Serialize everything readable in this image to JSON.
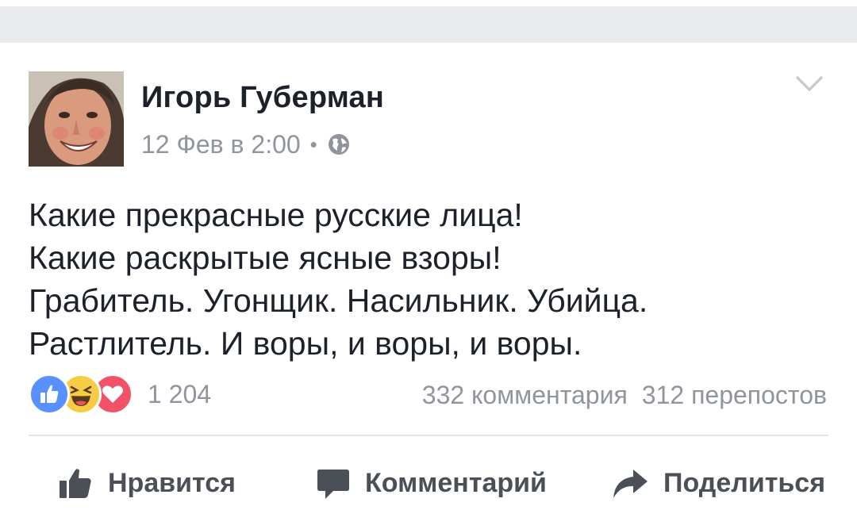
{
  "post": {
    "author": "Игорь Губерман",
    "timestamp": "12 Фев в 2:00",
    "separator": "•",
    "privacy_icon": "globe-icon",
    "menu_icon": "chevron-down-icon",
    "text_lines": [
      "Какие прекрасные русские лица!",
      "Какие раскрытые ясные взоры!",
      "Грабитель. Угонщик. Насильник. Убийца.",
      "Растлитель. И воры, и воры, и воры."
    ],
    "reactions": {
      "types": [
        "like",
        "haha",
        "love"
      ],
      "count": "1 204"
    },
    "comments": "332 комментария",
    "shares": "312 перепостов"
  },
  "actions": {
    "like_label": "Нравится",
    "comment_label": "Комментарий",
    "share_label": "Поделиться"
  },
  "colors": {
    "like": "#5890ff",
    "haha": "#f7cc45",
    "love": "#f25268",
    "text": "#1d2129",
    "meta": "#90949c",
    "action": "#4b4f56"
  }
}
